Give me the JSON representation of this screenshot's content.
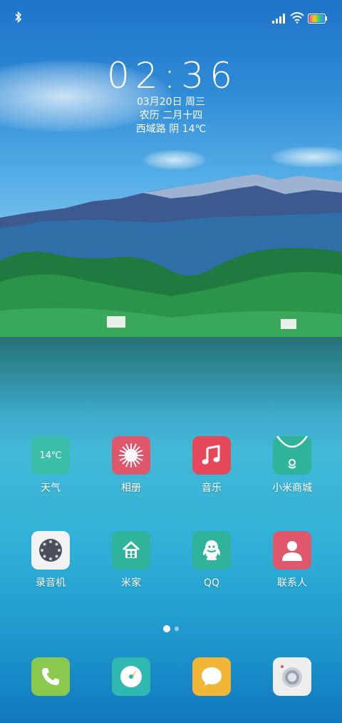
{
  "status_bar": {
    "bluetooth_icon": "bluetooth-icon",
    "signal_icon": "signal-icon",
    "wifi_icon": "wifi-icon",
    "battery_icon": "battery-icon"
  },
  "clock": {
    "time": "02:36",
    "date": "03月20日 周三",
    "lunar": "农历 二月十四",
    "weather": "西域路 阴 14℃"
  },
  "apps": [
    {
      "label": "天气",
      "tile_text": "14℃",
      "color": "#3bbfaa"
    },
    {
      "label": "相册",
      "color": "#e0566a"
    },
    {
      "label": "音乐",
      "color": "#e5485b"
    },
    {
      "label": "小米商城",
      "color": "#2fb39a"
    },
    {
      "label": "录音机",
      "color": "#f2f2f2"
    },
    {
      "label": "米家",
      "color": "#2fb39a"
    },
    {
      "label": "QQ",
      "color": "#2fb39a"
    },
    {
      "label": "联系人",
      "color": "#e0566a"
    }
  ],
  "pager": {
    "pages": 2,
    "current": 1
  },
  "dock": [
    {
      "name": "phone",
      "color": "#8bc84e"
    },
    {
      "name": "browser",
      "color": "#2fb8b0"
    },
    {
      "name": "messages",
      "color": "#f2b636"
    },
    {
      "name": "camera",
      "color": "#eeeeee"
    }
  ]
}
